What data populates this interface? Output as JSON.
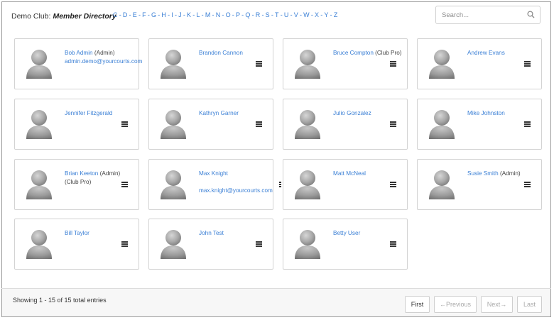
{
  "header": {
    "club_name": "Demo Club:",
    "directory_title": "Member Directory",
    "letters": [
      "C",
      "D",
      "E",
      "F",
      "G",
      "H",
      "I",
      "J",
      "K",
      "L",
      "M",
      "N",
      "O",
      "P",
      "Q",
      "R",
      "S",
      "T",
      "U",
      "V",
      "W",
      "X",
      "Y",
      "Z"
    ]
  },
  "search": {
    "placeholder": "Search..."
  },
  "members": [
    {
      "name": "Bob Admin",
      "role": "(Admin)",
      "email": "admin.demo@yourcourts.com",
      "menu": false
    },
    {
      "name": "Brandon Cannon",
      "role": "",
      "email": "",
      "menu": true
    },
    {
      "name": "Bruce Compton",
      "role": "(Club Pro)",
      "email": "",
      "menu": true
    },
    {
      "name": "Andrew Evans",
      "role": "",
      "email": "",
      "menu": true
    },
    {
      "name": "Jennifer Fitzgerald",
      "role": "",
      "email": "",
      "menu": true
    },
    {
      "name": "Kathryn Garner",
      "role": "",
      "email": "",
      "menu": true
    },
    {
      "name": "Julio Gonzalez",
      "role": "",
      "email": "",
      "menu": true
    },
    {
      "name": "Mike Johnston",
      "role": "",
      "email": "",
      "menu": true
    },
    {
      "name": "Brian Keeton",
      "role": "(Admin)  (Club Pro)",
      "email": "",
      "menu": true
    },
    {
      "name": "Max Knight",
      "role": "",
      "email": "max.knight@yourcourts.com",
      "menu": true
    },
    {
      "name": "Matt McNeal",
      "role": "",
      "email": "",
      "menu": true
    },
    {
      "name": "Susie Smith",
      "role": "(Admin)",
      "email": "",
      "menu": true
    },
    {
      "name": "Bill Taylor",
      "role": "",
      "email": "",
      "menu": true
    },
    {
      "name": "John Test",
      "role": "",
      "email": "",
      "menu": true
    },
    {
      "name": "Betty User",
      "role": "",
      "email": "",
      "menu": true
    }
  ],
  "footer": {
    "showing": "Showing 1 - 15 of 15 total entries",
    "first": "First",
    "previous": "←Previous",
    "next": "Next→",
    "last": "Last"
  }
}
